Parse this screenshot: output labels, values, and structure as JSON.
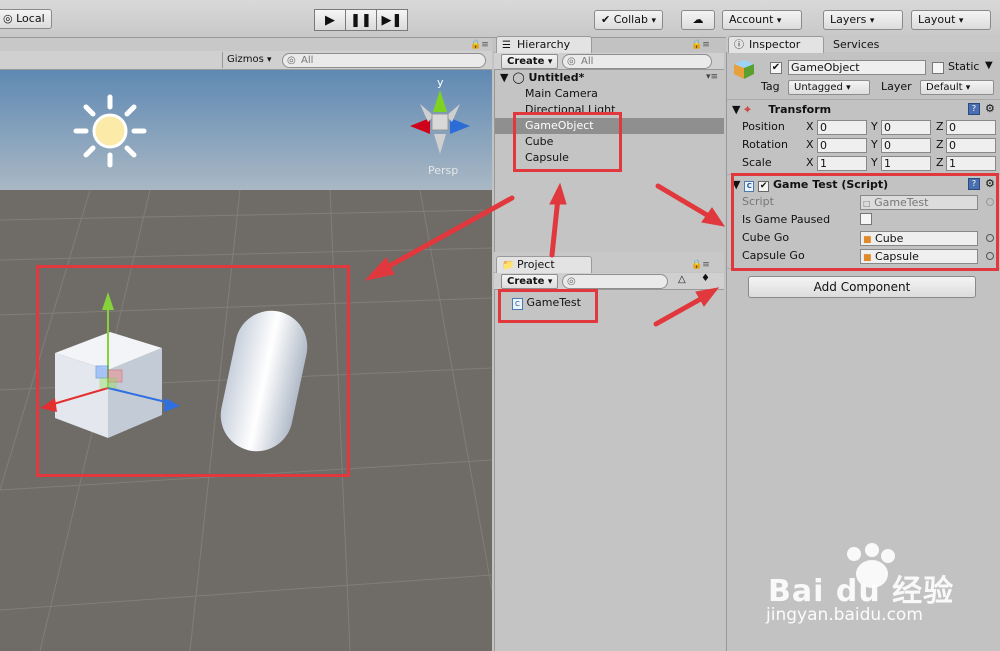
{
  "toolbar": {
    "local_label": "Local",
    "collab_label": "Collab",
    "account_label": "Account",
    "layers_label": "Layers",
    "layout_label": "Layout"
  },
  "scene": {
    "gizmos_label": "Gizmos",
    "search_placeholder": "All",
    "persp_label": "Persp",
    "axis_y": "y"
  },
  "hierarchy": {
    "tab_label": "Hierarchy",
    "create_label": "Create",
    "search_placeholder": "All",
    "scene_name": "Untitled*",
    "items": [
      "Main Camera",
      "Directional Light",
      "GameObject",
      "Cube",
      "Capsule"
    ],
    "selected_index": 2
  },
  "project": {
    "tab_label": "Project",
    "create_label": "Create",
    "asset": "GameTest"
  },
  "inspector": {
    "tab_label": "Inspector",
    "services_label": "Services",
    "object_name": "GameObject",
    "static_label": "Static",
    "tag_label": "Tag",
    "tag_value": "Untagged",
    "layer_label": "Layer",
    "layer_value": "Default",
    "transform": {
      "title": "Transform",
      "rows": [
        {
          "label": "Position",
          "x": "0",
          "y": "0",
          "z": "0"
        },
        {
          "label": "Rotation",
          "x": "0",
          "y": "0",
          "z": "0"
        },
        {
          "label": "Scale",
          "x": "1",
          "y": "1",
          "z": "1"
        }
      ],
      "axis": [
        "X",
        "Y",
        "Z"
      ]
    },
    "script_component": {
      "title": "Game Test (Script)",
      "script_label": "Script",
      "script_value": "GameTest",
      "paused_label": "Is Game Paused",
      "cube_label": "Cube Go",
      "cube_value": "Cube",
      "capsule_label": "Capsule Go",
      "capsule_value": "Capsule"
    },
    "add_component_label": "Add Component"
  },
  "watermark": {
    "brand": "Bai du 经验",
    "url": "jingyan.baidu.com"
  },
  "colors": {
    "highlight": "#e0383c",
    "selection": "#8f8f8f",
    "ground": "#6f6b66",
    "sky": "#7fa0c0"
  }
}
